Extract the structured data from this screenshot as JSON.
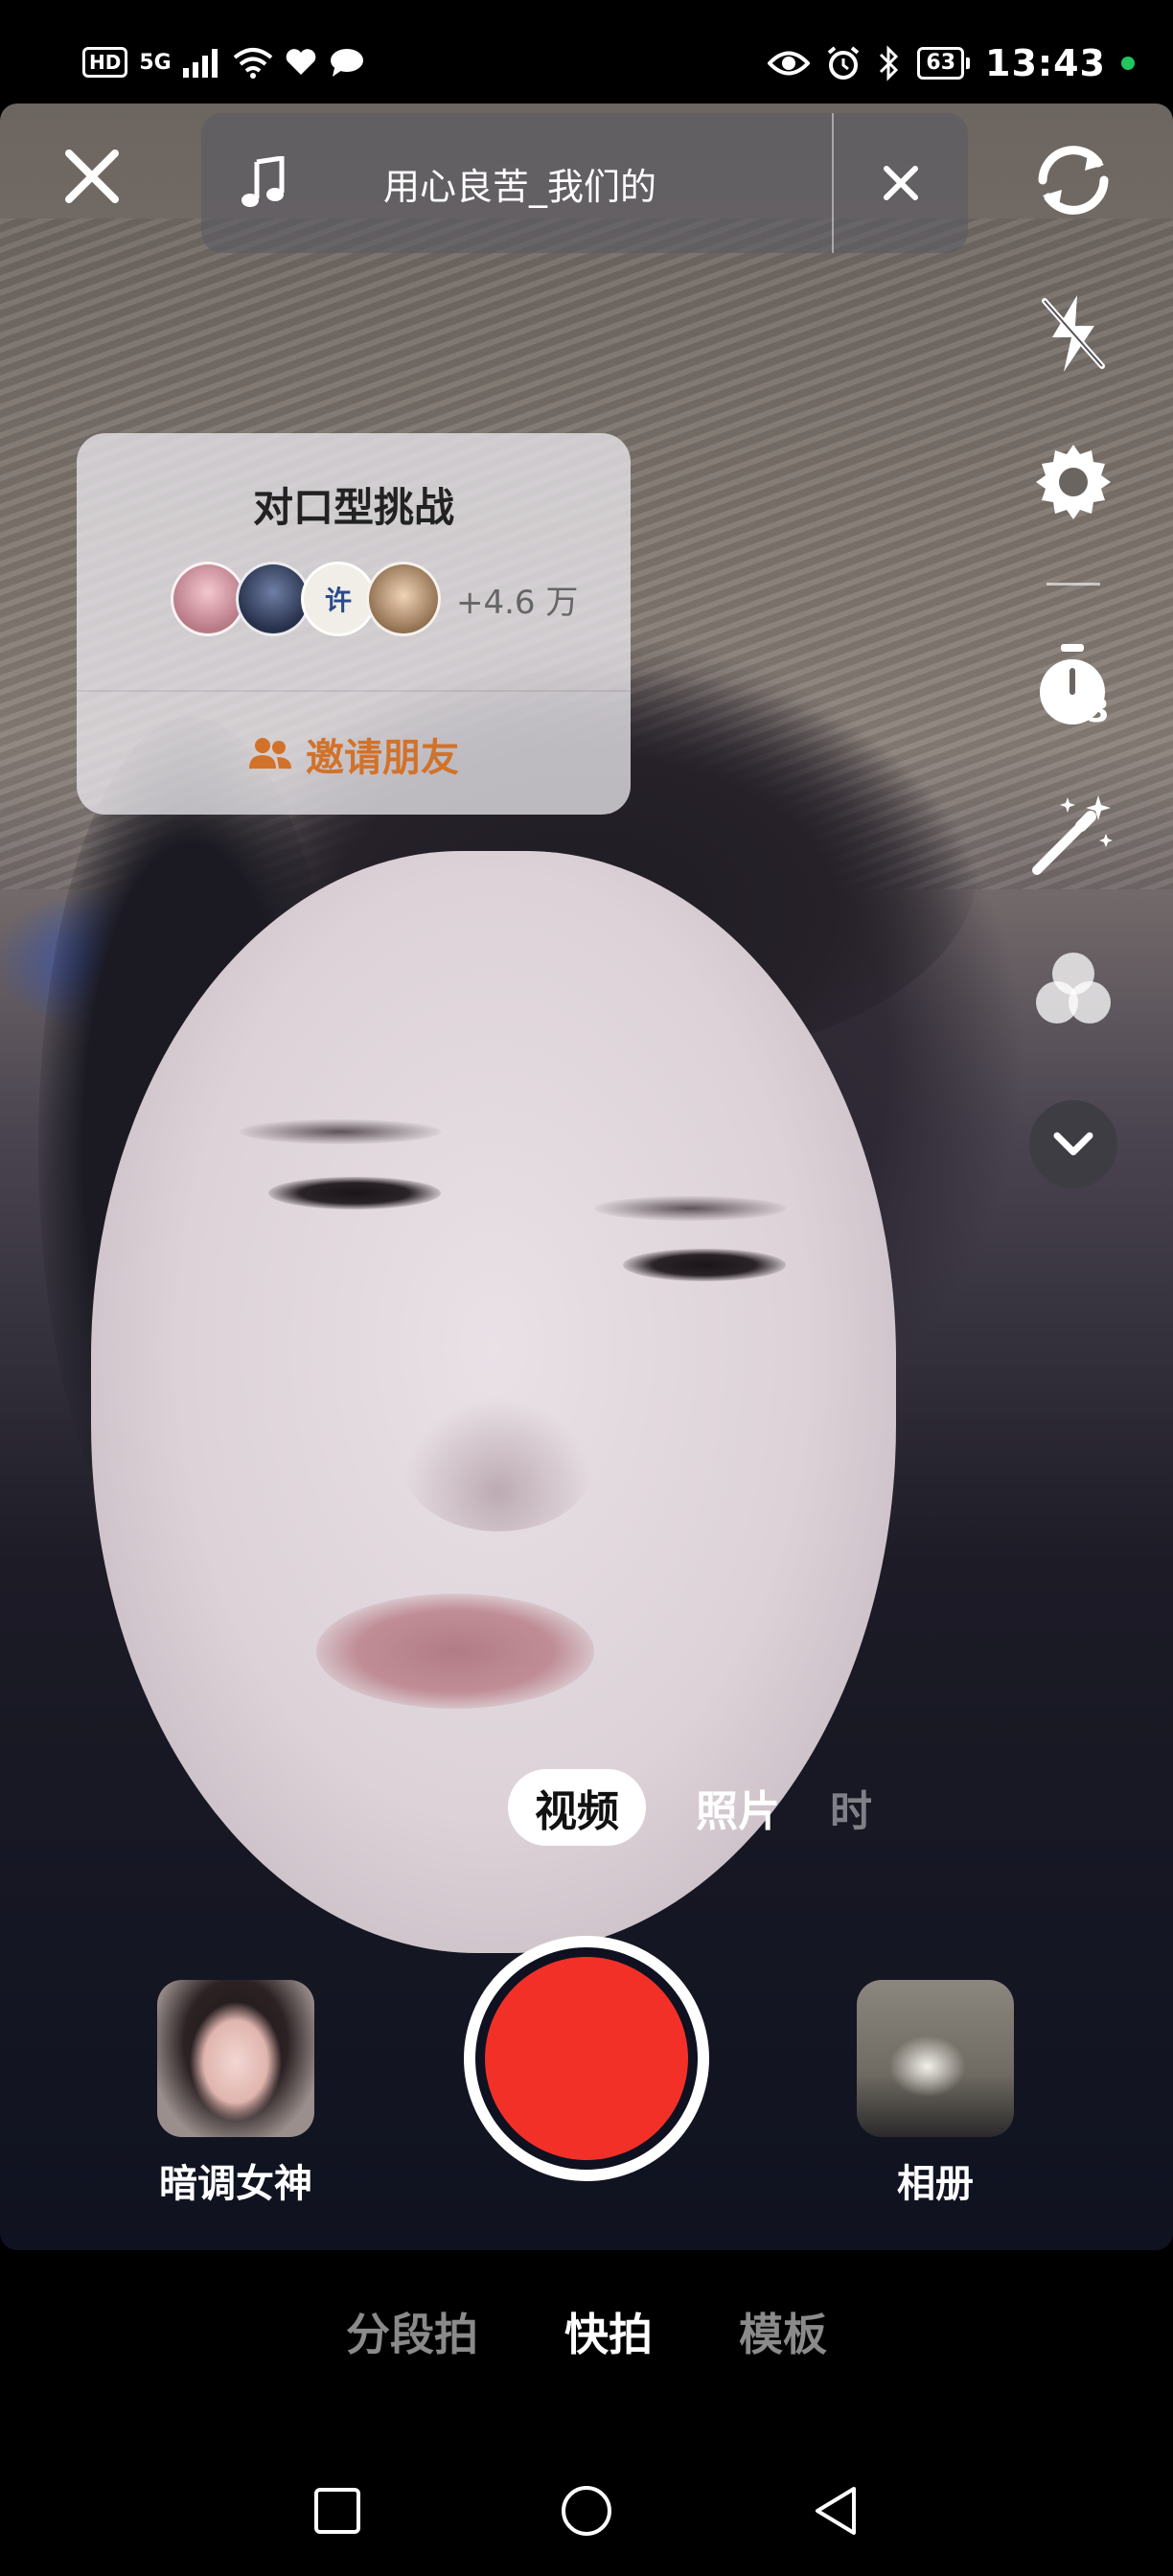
{
  "status_bar": {
    "network_badge": "HD",
    "network_type": "5G",
    "battery": "63",
    "time": "13:43"
  },
  "music": {
    "title": "用心良苦_我们的"
  },
  "challenge": {
    "title": "对口型挑战",
    "participants": "+4.6 万",
    "invite_label": "邀请朋友",
    "avatar_text": "许"
  },
  "right_toolbar": {
    "timer_count": "3"
  },
  "modes": {
    "active": "视频",
    "items": [
      "照片",
      "时"
    ]
  },
  "bottom": {
    "filter_label": "暗调女神",
    "album_label": "相册"
  },
  "tabs": [
    "分段拍",
    "快拍",
    "模板"
  ],
  "colors": {
    "shutter": "#f23028",
    "invite": "#d2722a",
    "status_dot": "#22c55e"
  }
}
